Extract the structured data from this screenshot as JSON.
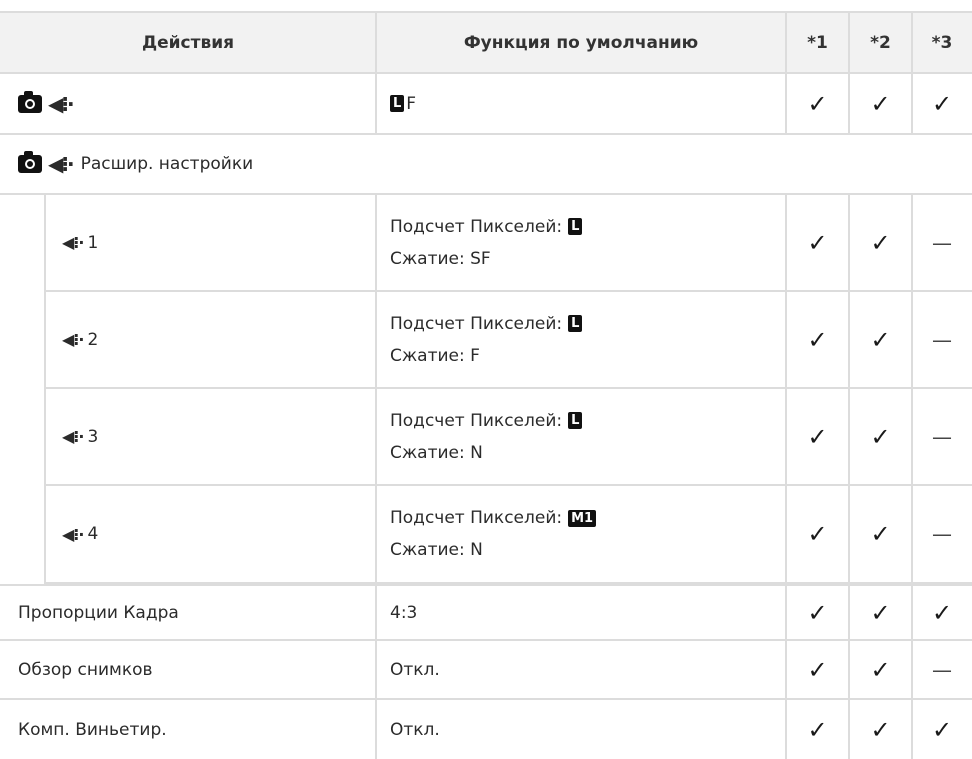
{
  "header": {
    "col_action": "Действия",
    "col_default": "Функция по умолчанию",
    "col_1": "*1",
    "col_2": "*2",
    "col_3": "*3"
  },
  "symbols": {
    "check": "✓",
    "dash": "—",
    "quality_icon": "◀⁝·",
    "L_box": "L",
    "M1_box": "M1"
  },
  "rows": {
    "r1": {
      "action_suffix": "",
      "default_value": "F",
      "c1": "✓",
      "c2": "✓",
      "c3": "✓"
    },
    "r2": {
      "action_suffix": "Расшир. настройки"
    },
    "q1": {
      "num": "1",
      "line1": "Подсчет Пикселей:",
      "line2": "Сжатие: SF",
      "c1": "✓",
      "c2": "✓",
      "c3": "—"
    },
    "q2": {
      "num": "2",
      "line1": "Подсчет Пикселей:",
      "line2": "Сжатие: F",
      "c1": "✓",
      "c2": "✓",
      "c3": "—"
    },
    "q3": {
      "num": "3",
      "line1": "Подсчет Пикселей:",
      "line2": "Сжатие: N",
      "c1": "✓",
      "c2": "✓",
      "c3": "—"
    },
    "q4": {
      "num": "4",
      "line1": "Подсчет Пикселей:",
      "line2": "Сжатие: N",
      "c1": "✓",
      "c2": "✓",
      "c3": "—"
    },
    "aspect": {
      "label": "Пропорции Кадра",
      "value": "4:3",
      "c1": "✓",
      "c2": "✓",
      "c3": "✓"
    },
    "review": {
      "label": "Обзор снимков",
      "value": "Откл.",
      "c1": "✓",
      "c2": "✓",
      "c3": "—"
    },
    "vignette": {
      "label": "Комп. Виньетир.",
      "value": "Откл.",
      "c1": "✓",
      "c2": "✓",
      "c3": "✓"
    }
  }
}
